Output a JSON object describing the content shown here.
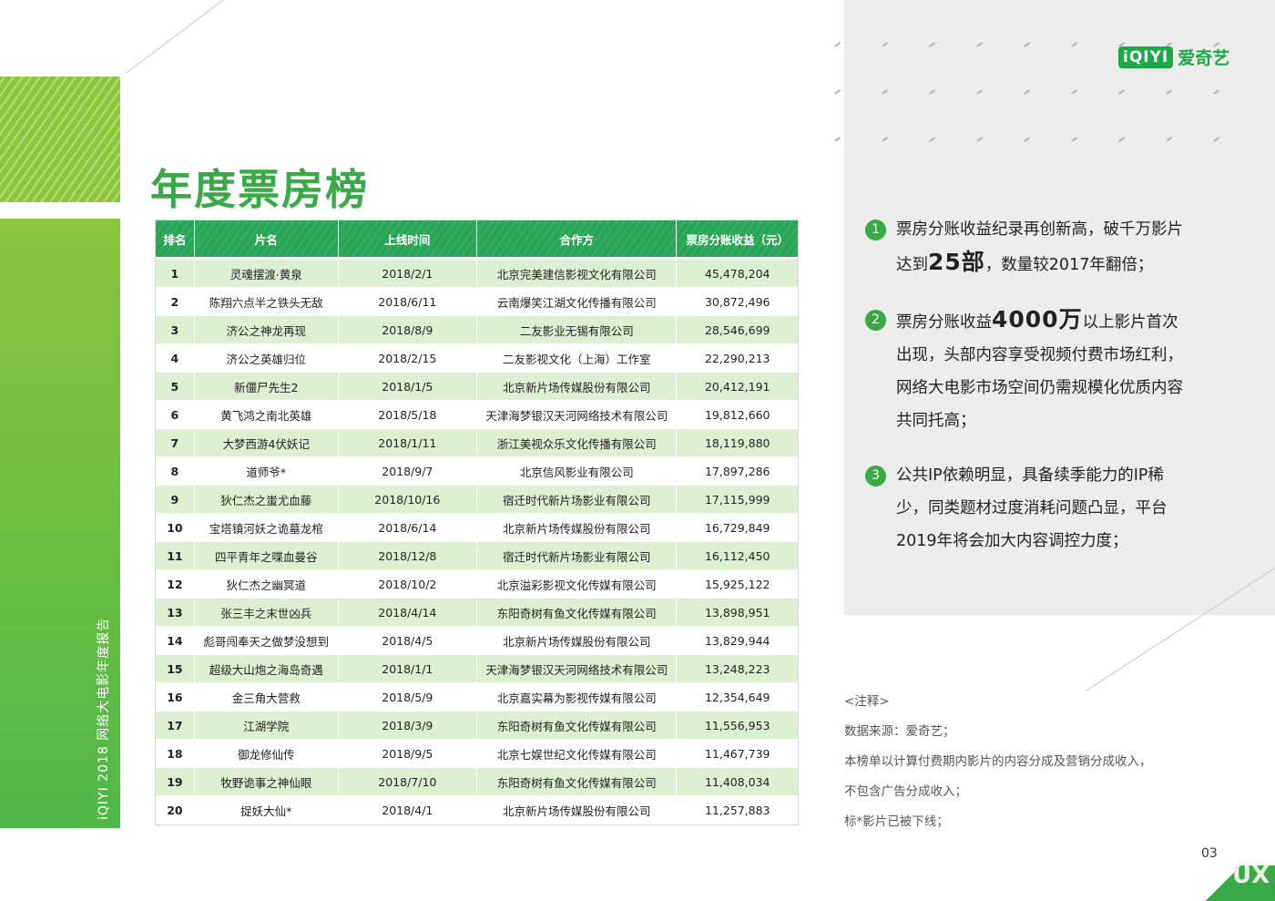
{
  "logo": {
    "mark": "iQIYI",
    "text": "爱奇艺"
  },
  "side_text": "iQIYI  2018 网络大电影年度报告",
  "title": "年度票房榜",
  "table": {
    "headers": [
      "排名",
      "片名",
      "上线时间",
      "合作方",
      "票房分账收益（元）"
    ],
    "rows": [
      [
        "1",
        "灵魂摆渡·黄泉",
        "2018/2/1",
        "北京完美建信影视文化有限公司",
        "45,478,204"
      ],
      [
        "2",
        "陈翔六点半之铁头无敌",
        "2018/6/11",
        "云南爆笑江湖文化传播有限公司",
        "30,872,496"
      ],
      [
        "3",
        "济公之神龙再现",
        "2018/8/9",
        "二友影业无锡有限公司",
        "28,546,699"
      ],
      [
        "4",
        "济公之英雄归位",
        "2018/2/15",
        "二友影视文化（上海）工作室",
        "22,290,213"
      ],
      [
        "5",
        "新僵尸先生2",
        "2018/1/5",
        "北京新片场传媒股份有限公司",
        "20,412,191"
      ],
      [
        "6",
        "黄飞鸿之南北英雄",
        "2018/5/18",
        "天津海梦银汉天河网络技术有限公司",
        "19,812,660"
      ],
      [
        "7",
        "大梦西游4伏妖记",
        "2018/1/11",
        "浙江美视众乐文化传播有限公司",
        "18,119,880"
      ],
      [
        "8",
        "道师爷*",
        "2018/9/7",
        "北京信风影业有限公司",
        "17,897,286"
      ],
      [
        "9",
        "狄仁杰之蚩尤血藤",
        "2018/10/16",
        "宿迁时代新片场影业有限公司",
        "17,115,999"
      ],
      [
        "10",
        "宝塔镇河妖之诡墓龙棺",
        "2018/6/14",
        "北京新片场传媒股份有限公司",
        "16,729,849"
      ],
      [
        "11",
        "四平青年之喋血曼谷",
        "2018/12/8",
        "宿迁时代新片场影业有限公司",
        "16,112,450"
      ],
      [
        "12",
        "狄仁杰之幽冥道",
        "2018/10/2",
        "北京溢彩影视文化传媒有限公司",
        "15,925,122"
      ],
      [
        "13",
        "张三丰之末世凶兵",
        "2018/4/14",
        "东阳奇树有鱼文化传媒有限公司",
        "13,898,951"
      ],
      [
        "14",
        "彪哥闯奉天之做梦没想到",
        "2018/4/5",
        "北京新片场传媒股份有限公司",
        "13,829,944"
      ],
      [
        "15",
        "超级大山炮之海岛奇遇",
        "2018/1/1",
        "天津海梦银汉天河网络技术有限公司",
        "13,248,223"
      ],
      [
        "16",
        "金三角大营救",
        "2018/5/9",
        "北京嘉实幕为影视传媒有限公司",
        "12,354,649"
      ],
      [
        "17",
        "江湖学院",
        "2018/3/9",
        "东阳奇树有鱼文化传媒有限公司",
        "11,556,953"
      ],
      [
        "18",
        "御龙修仙传",
        "2018/9/5",
        "北京七娱世纪文化传媒有限公司",
        "11,467,739"
      ],
      [
        "19",
        "牧野诡事之神仙眼",
        "2018/7/10",
        "东阳奇树有鱼文化传媒有限公司",
        "11,408,034"
      ],
      [
        "20",
        "捉妖大仙*",
        "2018/4/1",
        "北京新片场传媒股份有限公司",
        "11,257,883"
      ]
    ]
  },
  "points": [
    {
      "num": "1",
      "pre": "票房分账收益纪录再创新高，破千万影片达到",
      "big": "25部",
      "post": "，数量较2017年翻倍；"
    },
    {
      "num": "2",
      "pre": "票房分账收益",
      "big": "4000万",
      "post": "以上影片首次出现，头部内容享受视频付费市场红利，网络大电影市场空间仍需规模化优质内容共同托高；"
    },
    {
      "num": "3",
      "pre": "公共IP依赖明显，具备续季能力的IP稀少，同类题材过度消耗问题凸显，平台2019年将会加大内容调控力度；",
      "big": "",
      "post": ""
    }
  ],
  "notes": {
    "heading": "<注释>",
    "lines": [
      "数据来源：爱奇艺；",
      "本榜单以计算付费期内影片的内容分成及营销分成收入，",
      "不包含广告分成收入；",
      "标*影片已被下线；"
    ]
  },
  "page_number": "03",
  "corner_mark": "UX",
  "colors": {
    "brand_green": "#3aaa48",
    "header_green": "#2aa457",
    "row_stripe": "#dcefd0",
    "panel_gray": "#ececec"
  }
}
